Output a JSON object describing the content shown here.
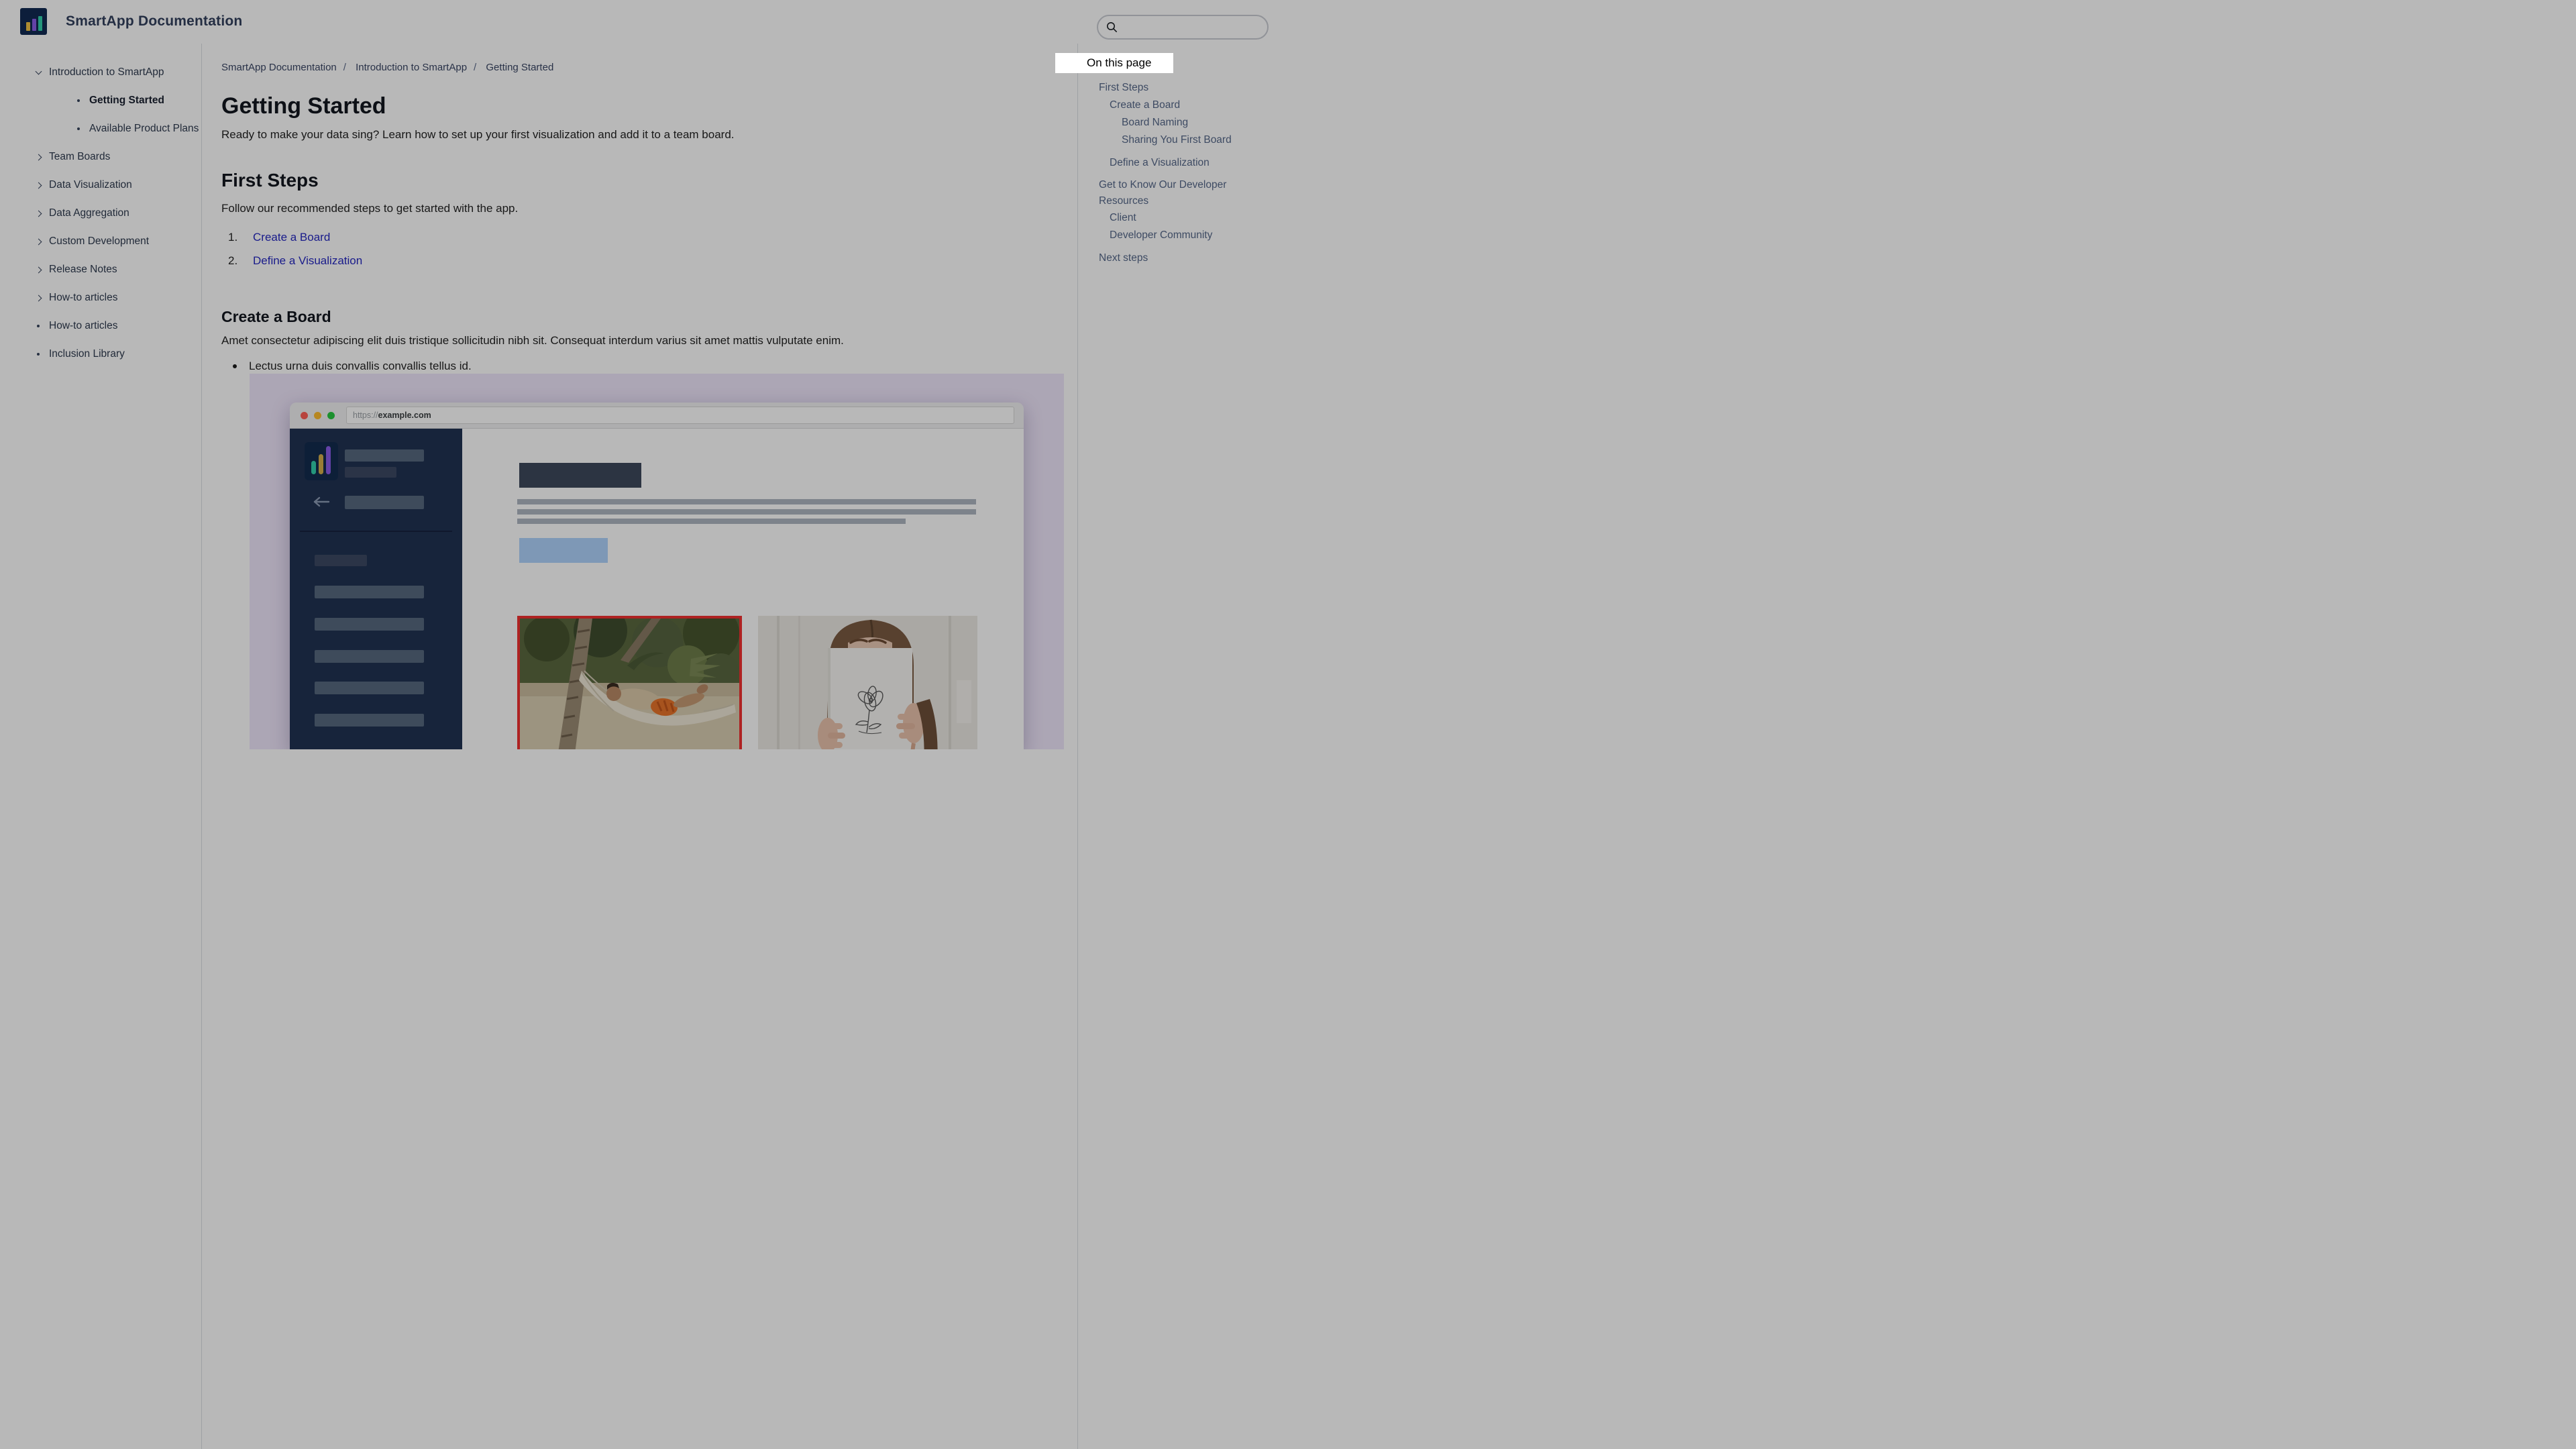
{
  "header": {
    "title": "SmartApp Documentation",
    "logo_icon": "bar-chart-logo",
    "search": {
      "placeholder": "",
      "value": ""
    }
  },
  "sidebar": {
    "items": [
      {
        "label": "Introduction to SmartApp",
        "marker": "m-chev-down",
        "row": "",
        "cls": ""
      },
      {
        "label": "Getting Started",
        "marker": "m-dot",
        "row": "child",
        "cls": "active"
      },
      {
        "label": "Available Product Plans",
        "marker": "m-dot",
        "row": "child",
        "cls": ""
      },
      {
        "label": "Team Boards",
        "marker": "m-chev-right",
        "row": "",
        "cls": ""
      },
      {
        "label": "Data Visualization",
        "marker": "m-chev-right",
        "row": "",
        "cls": ""
      },
      {
        "label": "Data Aggregation",
        "marker": "m-chev-right",
        "row": "",
        "cls": ""
      },
      {
        "label": "Custom Development",
        "marker": "m-chev-right",
        "row": "",
        "cls": ""
      },
      {
        "label": "Release Notes",
        "marker": "m-chev-right",
        "row": "",
        "cls": ""
      },
      {
        "label": "How-to articles",
        "marker": "m-chev-right",
        "row": "",
        "cls": ""
      },
      {
        "label": "How-to articles",
        "marker": "m-dot",
        "row": "",
        "cls": ""
      },
      {
        "label": "Inclusion Library",
        "marker": "m-dot",
        "row": "",
        "cls": ""
      }
    ]
  },
  "breadcrumb": {
    "items": [
      {
        "label": "SmartApp Documentation",
        "sep": "/"
      },
      {
        "label": "Introduction to SmartApp",
        "sep": "/"
      },
      {
        "label": "Getting Started",
        "sep": ""
      }
    ]
  },
  "article": {
    "title": "Getting Started",
    "intro": "Ready to make your data sing? Learn how to set up your first visualization and add it to a team board.",
    "first_steps": {
      "heading": "First Steps",
      "body": "Follow our recommended steps to get started with the app.",
      "steps": [
        {
          "num": "1.",
          "label": "Create a Board"
        },
        {
          "num": "2.",
          "label": "Define a Visualization"
        }
      ]
    },
    "create_board": {
      "heading": "Create a Board",
      "body": "Amet consectetur adipiscing elit duis tristique sollicitudin nibh sit. Consequat interdum varius sit amet mattis vulputate enim.",
      "bullet": "Lectus urna duis convallis convallis tellus id."
    }
  },
  "figure": {
    "browser": {
      "url_scheme": "https://",
      "url_host": "example.com",
      "traffic_lights": [
        "close",
        "minimize",
        "zoom"
      ],
      "photos": [
        "man-in-hammock-photo (red highlight border)",
        "woman-holding-flower-poster-photo"
      ]
    }
  },
  "toc": {
    "heading": "On this page",
    "items": [
      {
        "label": "First Steps",
        "cls": "l1"
      },
      {
        "label": "Create a Board",
        "cls": "l2"
      },
      {
        "label": "Board Naming",
        "cls": "l3"
      },
      {
        "label": "Sharing You First Board",
        "cls": "l3"
      },
      {
        "label": "Define a Visualization",
        "cls": "l2 gap"
      },
      {
        "label": "Get to Know Our Developer Resources",
        "cls": "l1 gap wrap"
      },
      {
        "label": "Client",
        "cls": "l2"
      },
      {
        "label": "Developer Community",
        "cls": "l2"
      },
      {
        "label": "Next steps",
        "cls": "l1 gap"
      }
    ]
  },
  "colors": {
    "link": "#2528C1",
    "figure_background": "#EFE6FB",
    "photo_highlight_border": "#F23030",
    "logo_navy": "#112A52",
    "logo_gold": "#F0C345",
    "logo_purple": "#8A5CE8",
    "logo_teal": "#32D0AC",
    "mock_sidebar_navy": "#213253",
    "dim_overlay": "rgba(0,0,0,0.28)"
  }
}
